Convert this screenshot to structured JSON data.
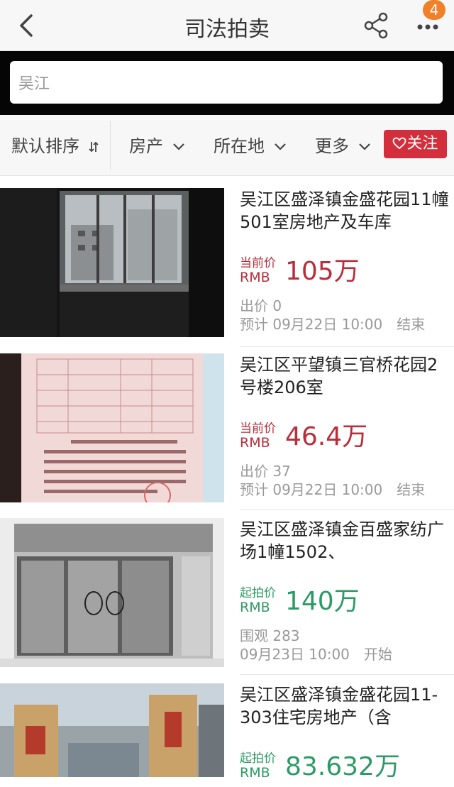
{
  "header": {
    "title": "司法拍卖",
    "badge_count": "4"
  },
  "search": {
    "value": "吴江"
  },
  "filters": {
    "sort": "默认排序",
    "type": "房产",
    "location": "所在地",
    "more": "更多",
    "follow": "关注"
  },
  "colors": {
    "ongoing_price": "#b82e3a",
    "starting_price": "#2d9a66",
    "follow_button": "#d32e3c",
    "badge": "#f08128"
  },
  "listings": [
    {
      "title": "吴江区盛泽镇金盛花园11幢501室房地产及车库",
      "price_label": "当前价",
      "currency": "RMB",
      "price": "105万",
      "stat": "出价 0",
      "time": "预计 09月22日 10:00　结束"
    },
    {
      "title": "吴江区平望镇三官桥花园2号楼206室",
      "price_label": "当前价",
      "currency": "RMB",
      "price": "46.4万",
      "stat": "出价 37",
      "time": "预计 09月22日 10:00　结束"
    },
    {
      "title": "吴江区盛泽镇金百盛家纺广场1幢1502、",
      "price_label": "起拍价",
      "currency": "RMB",
      "price": "140万",
      "stat": "围观 283",
      "time": "09月23日 10:00　开始"
    },
    {
      "title": "吴江区盛泽镇金盛花园11-303住宅房地产（含",
      "price_label": "起拍价",
      "currency": "RMB",
      "price": "83.632万"
    }
  ]
}
